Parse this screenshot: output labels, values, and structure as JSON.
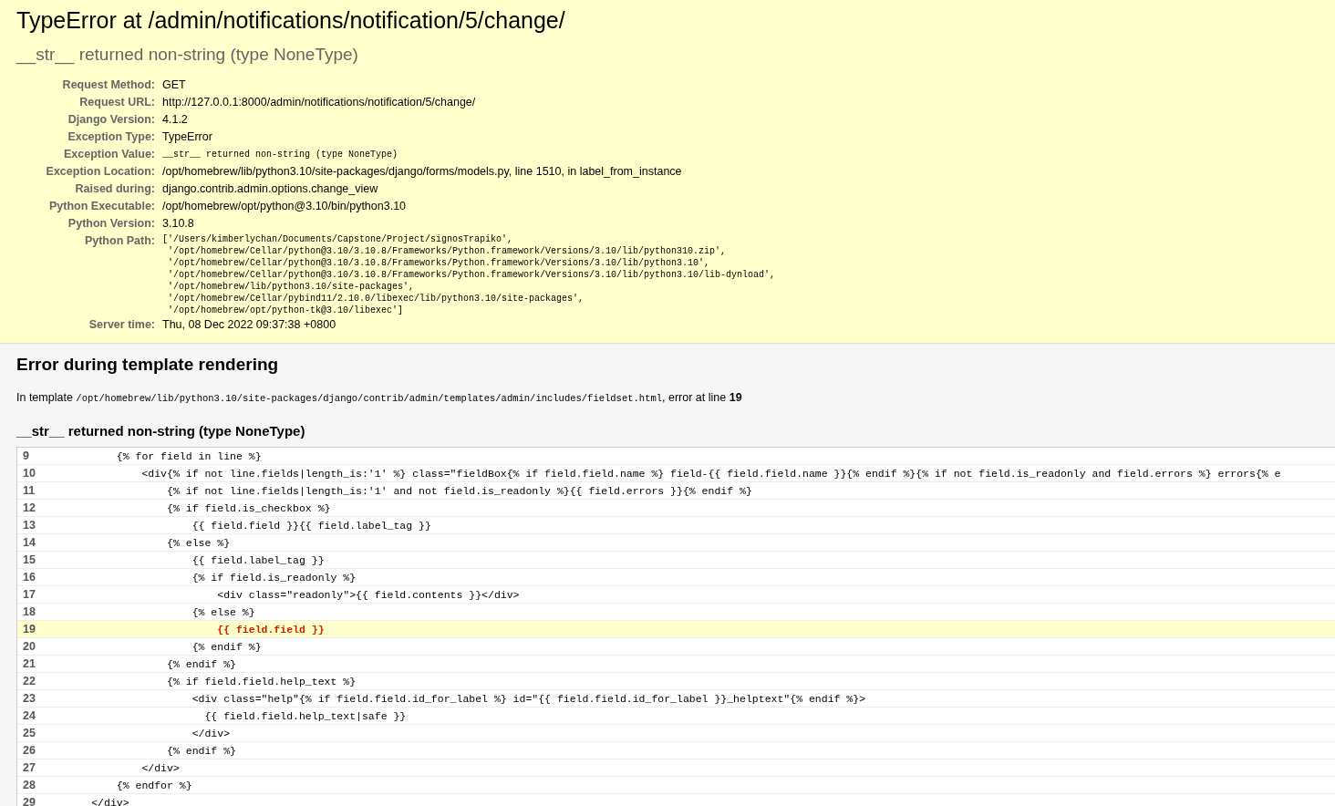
{
  "summary": {
    "title": "TypeError at /admin/notifications/notification/5/change/",
    "subtitle": "__str__ returned non-string (type NoneType)",
    "meta": [
      {
        "label": "Request Method:",
        "kind": "text",
        "value": [
          "GET"
        ]
      },
      {
        "label": "Request URL:",
        "kind": "text",
        "value": [
          "http://127.0.0.1:8000/admin/notifications/notification/5/change/"
        ]
      },
      {
        "label": "Django Version:",
        "kind": "text",
        "value": [
          "4.1.2"
        ]
      },
      {
        "label": "Exception Type:",
        "kind": "text",
        "value": [
          "TypeError"
        ]
      },
      {
        "label": "Exception Value:",
        "kind": "code",
        "value": [
          "__str__ returned non-string (type NoneType)"
        ]
      },
      {
        "label": "Exception Location:",
        "kind": "text",
        "value": [
          "/opt/homebrew/lib/python3.10/site-packages/django/forms/models.py, line 1510, in label_from_instance"
        ]
      },
      {
        "label": "Raised during:",
        "kind": "text",
        "value": [
          "django.contrib.admin.options.change_view"
        ]
      },
      {
        "label": "Python Executable:",
        "kind": "text",
        "value": [
          "/opt/homebrew/opt/python@3.10/bin/python3.10"
        ]
      },
      {
        "label": "Python Version:",
        "kind": "text",
        "value": [
          "3.10.8"
        ]
      },
      {
        "label": "Python Path:",
        "kind": "code",
        "value": [
          "['/Users/kimberlychan/Documents/Capstone/Project/signosTrapiko',",
          " '/opt/homebrew/Cellar/python@3.10/3.10.8/Frameworks/Python.framework/Versions/3.10/lib/python310.zip',",
          " '/opt/homebrew/Cellar/python@3.10/3.10.8/Frameworks/Python.framework/Versions/3.10/lib/python3.10',",
          " '/opt/homebrew/Cellar/python@3.10/3.10.8/Frameworks/Python.framework/Versions/3.10/lib/python3.10/lib-dynload',",
          " '/opt/homebrew/lib/python3.10/site-packages',",
          " '/opt/homebrew/Cellar/pybind11/2.10.0/libexec/lib/python3.10/site-packages',",
          " '/opt/homebrew/opt/python-tk@3.10/libexec']"
        ]
      },
      {
        "label": "Server time:",
        "kind": "text",
        "value": [
          "Thu, 08 Dec 2022 09:37:38 +0800"
        ]
      }
    ]
  },
  "template": {
    "heading": "Error during template rendering",
    "intro_prefix": "In template",
    "path": "/opt/homebrew/lib/python3.10/site-packages/django/contrib/admin/templates/admin/includes/fieldset.html",
    "intro_suffix": ", error at line **19**",
    "error": "__str__ returned non-string (type NoneType)",
    "lines": [
      {
        "number": "9",
        "code": "            {% for field in line %}",
        "selected": false
      },
      {
        "number": "10",
        "code": "                <div{% if not line.fields|length_is:'1' %} class=\"fieldBox{% if field.field.name %} field-{{ field.field.name }}{% endif %}{% if not field.is_readonly and field.errors %} errors{% e",
        "selected": false
      },
      {
        "number": "11",
        "code": "                    {% if not line.fields|length_is:'1' and not field.is_readonly %}{{ field.errors }}{% endif %}",
        "selected": false
      },
      {
        "number": "12",
        "code": "                    {% if field.is_checkbox %}",
        "selected": false
      },
      {
        "number": "13",
        "code": "                        {{ field.field }}{{ field.label_tag }}",
        "selected": false
      },
      {
        "number": "14",
        "code": "                    {% else %}",
        "selected": false
      },
      {
        "number": "15",
        "code": "                        {{ field.label_tag }}",
        "selected": false
      },
      {
        "number": "16",
        "code": "                        {% if field.is_readonly %}",
        "selected": false
      },
      {
        "number": "17",
        "code": "                            <div class=\"readonly\">{{ field.contents }}</div>",
        "selected": false
      },
      {
        "number": "18",
        "code": "                        {% else %}",
        "selected": false
      },
      {
        "number": "19",
        "code": "                            {{ field.field }}",
        "selected": true
      },
      {
        "number": "20",
        "code": "                        {% endif %}",
        "selected": false
      },
      {
        "number": "21",
        "code": "                    {% endif %}",
        "selected": false
      },
      {
        "number": "22",
        "code": "                    {% if field.field.help_text %}",
        "selected": false
      },
      {
        "number": "23",
        "code": "                        <div class=\"help\"{% if field.field.id_for_label %} id=\"{{ field.field.id_for_label }}_helptext\"{% endif %}>",
        "selected": false
      },
      {
        "number": "24",
        "code": "                          {{ field.field.help_text|safe }}",
        "selected": false
      },
      {
        "number": "25",
        "code": "                        </div>",
        "selected": false
      },
      {
        "number": "26",
        "code": "                    {% endif %}",
        "selected": false
      },
      {
        "number": "27",
        "code": "                </div>",
        "selected": false
      },
      {
        "number": "28",
        "code": "            {% endfor %}",
        "selected": false
      },
      {
        "number": "29",
        "code": "        </div>",
        "selected": false
      }
    ]
  }
}
